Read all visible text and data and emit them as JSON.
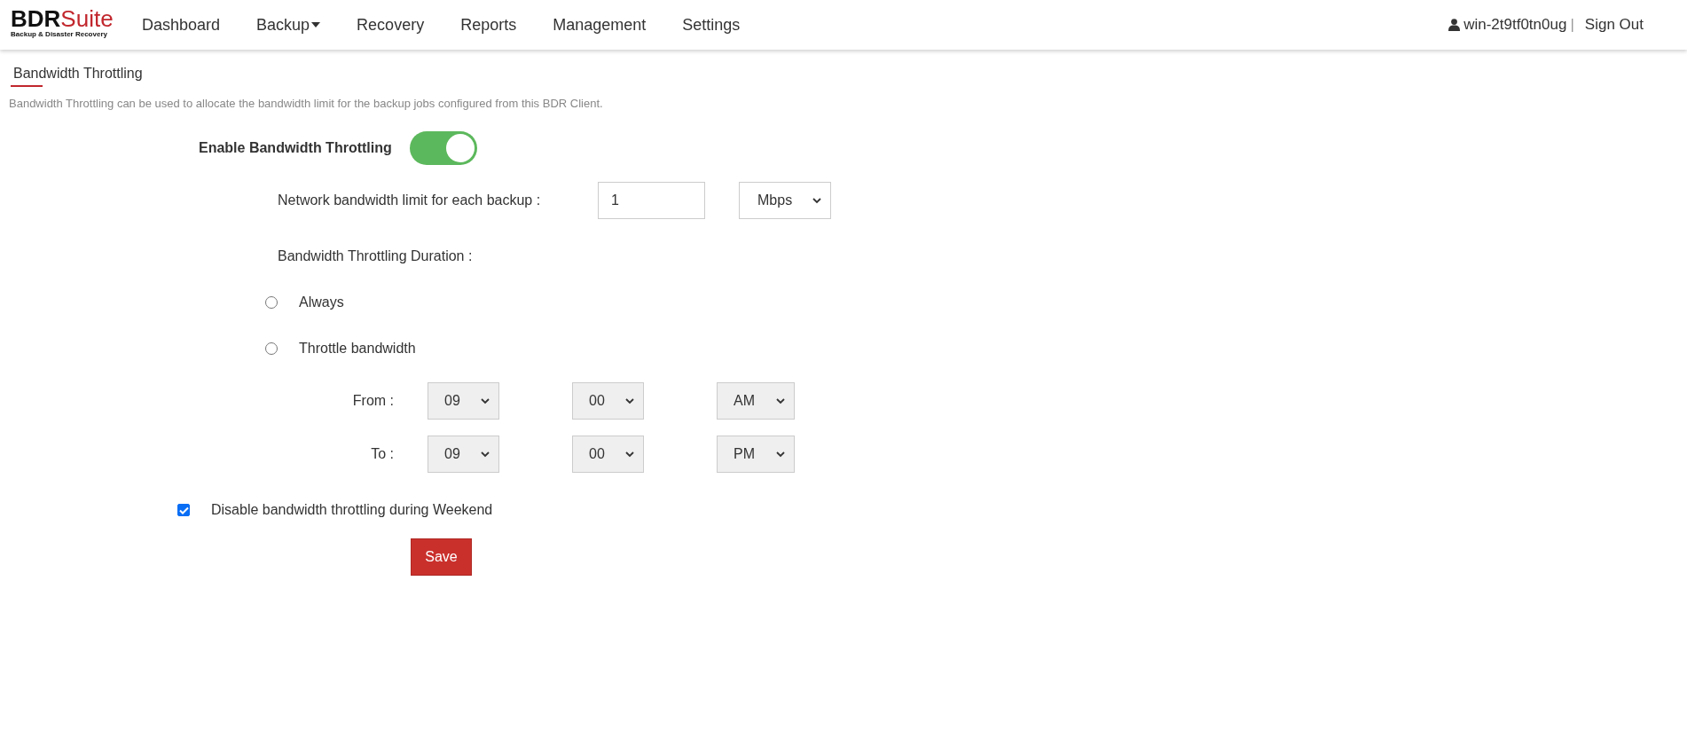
{
  "logo": {
    "wordmark_dark": "BDR",
    "wordmark_accent": "Suite",
    "tagline": "Backup & Disaster Recovery"
  },
  "nav": [
    {
      "label": "Dashboard",
      "dropdown": false
    },
    {
      "label": "Backup",
      "dropdown": true
    },
    {
      "label": "Recovery",
      "dropdown": false
    },
    {
      "label": "Reports",
      "dropdown": false
    },
    {
      "label": "Management",
      "dropdown": false
    },
    {
      "label": "Settings",
      "dropdown": false
    }
  ],
  "user": {
    "name": "win-2t9tf0tn0ug",
    "separator": "|",
    "sign_out": "Sign Out"
  },
  "page": {
    "title": "Bandwidth Throttling",
    "description": "Bandwidth Throttling can be used to allocate the bandwidth limit for the backup jobs configured from this BDR Client."
  },
  "enable": {
    "label": "Enable Bandwidth Throttling",
    "on": true
  },
  "limit": {
    "label": "Network bandwidth limit for each backup :",
    "value": "1",
    "unit": "Mbps"
  },
  "duration": {
    "label": "Bandwidth Throttling Duration :",
    "options": [
      {
        "label": "Always",
        "selected": false
      },
      {
        "label": "Throttle bandwidth",
        "selected": false
      }
    ]
  },
  "times": [
    {
      "label": "From :",
      "hour": "09",
      "minute": "00",
      "period": "AM"
    },
    {
      "label": "To :",
      "hour": "09",
      "minute": "00",
      "period": "PM"
    }
  ],
  "weekend": {
    "label": "Disable bandwidth throttling during Weekend",
    "checked": true
  },
  "save": "Save"
}
